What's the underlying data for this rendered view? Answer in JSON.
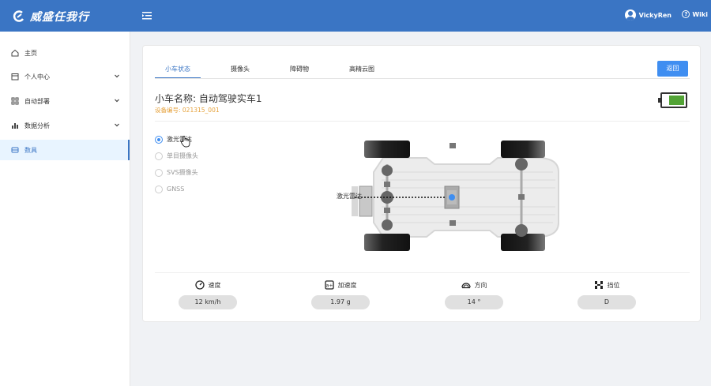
{
  "app": {
    "logo_text": "威盛任我行",
    "user_name": "VickyRen",
    "wiki_label": "Wiki"
  },
  "sidebar": {
    "items": [
      {
        "label": "主页",
        "icon": "home-icon"
      },
      {
        "label": "个人中心",
        "icon": "calendar-icon",
        "has_submenu": true
      },
      {
        "label": "自动部署",
        "icon": "grid-icon",
        "has_submenu": true
      },
      {
        "label": "数据分析",
        "icon": "bar-chart-icon",
        "has_submenu": true
      },
      {
        "label": "数具",
        "icon": "car-icon",
        "active": true
      }
    ]
  },
  "tabs": [
    {
      "label": "小车状态",
      "active": true
    },
    {
      "label": "摄像头"
    },
    {
      "label": "障碍物"
    },
    {
      "label": "高精云图"
    }
  ],
  "back_button": "返回",
  "car": {
    "title": "小车名称: 自动驾驶实车1",
    "device_no": "设备编号: 021315_001",
    "battery_color": "#52a335"
  },
  "sensors": [
    {
      "label": "激光雷达",
      "checked": true
    },
    {
      "label": "单目摄像头"
    },
    {
      "label": "SVS摄像头"
    },
    {
      "label": "GNSS"
    }
  ],
  "diagram": {
    "lidar_label": "激光雷达",
    "accent": "#3f8ef1"
  },
  "stats": [
    {
      "label": "速度",
      "value": "12 km/h",
      "icon": "speedometer-icon"
    },
    {
      "label": "加速度",
      "value": "1.97 g",
      "icon": "acceleration-icon"
    },
    {
      "label": "方向",
      "value": "14 °",
      "icon": "steering-icon"
    },
    {
      "label": "挡位",
      "value": "D",
      "icon": "gear-shift-icon"
    }
  ]
}
